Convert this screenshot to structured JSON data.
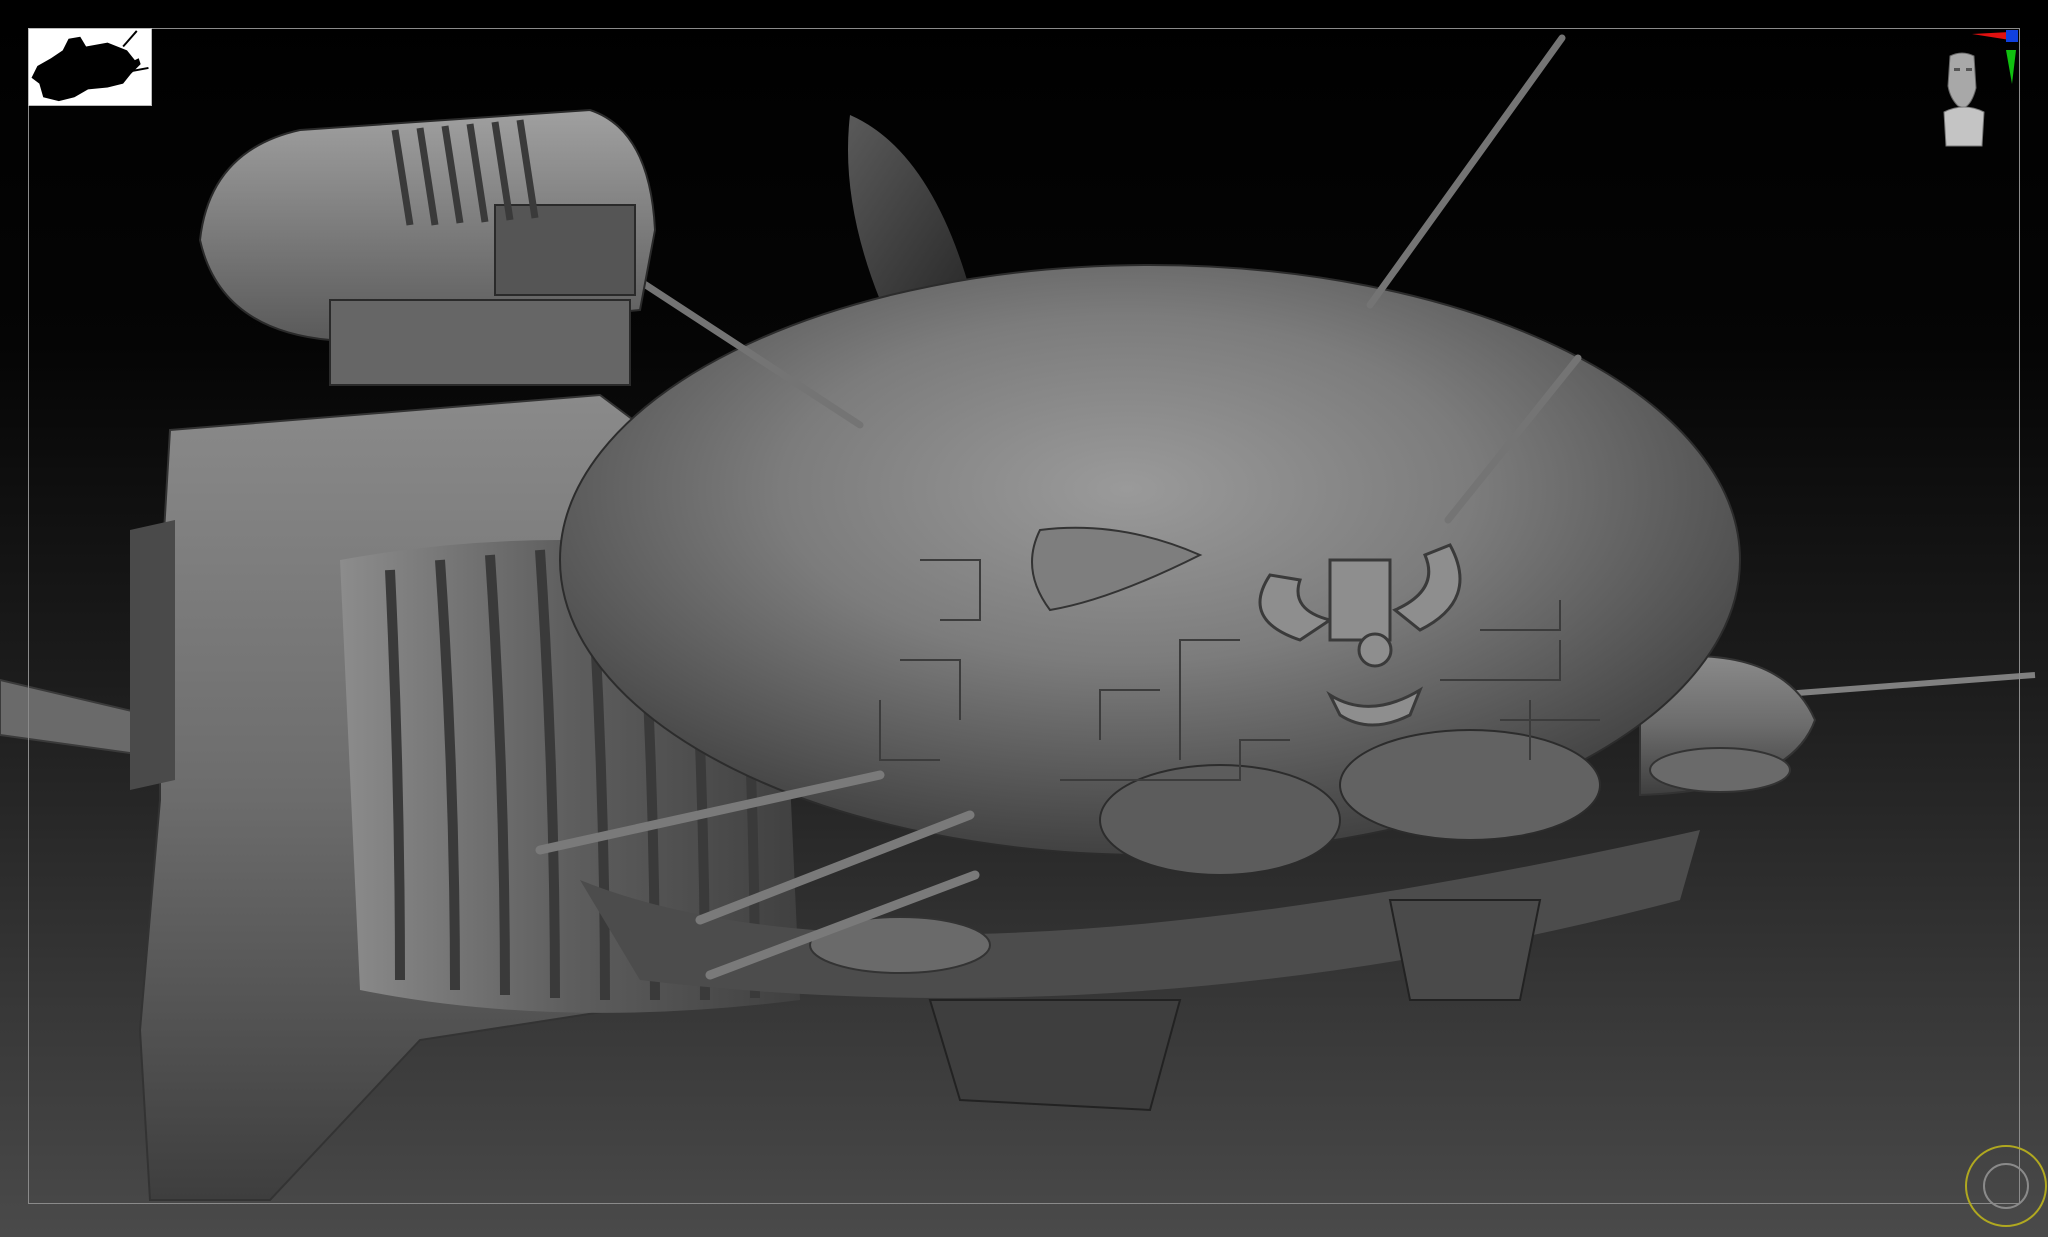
{
  "app": {
    "title": "",
    "viewport_background": "gradient-black-to-gray",
    "accent_colors": {
      "axis_x": "#e01010",
      "axis_y": "#10c010",
      "axis_z": "#1040e0",
      "floor_grid_ring": "#b0a820",
      "frame_border": "#8a8a8a",
      "navigator_bg": "#ffffff",
      "model_gray": "#6e6e6e"
    }
  },
  "viewport": {
    "navigator_thumbnail": {
      "icon": "spaceship-silhouette-icon"
    },
    "orientation_gizmo": {
      "icon": "head-bust-icon",
      "axes": [
        "x",
        "y",
        "z"
      ]
    },
    "floor_grid": {
      "icon": "floor-ring-icon"
    },
    "model": {
      "icon": "sculpted-spaceship-model"
    }
  }
}
